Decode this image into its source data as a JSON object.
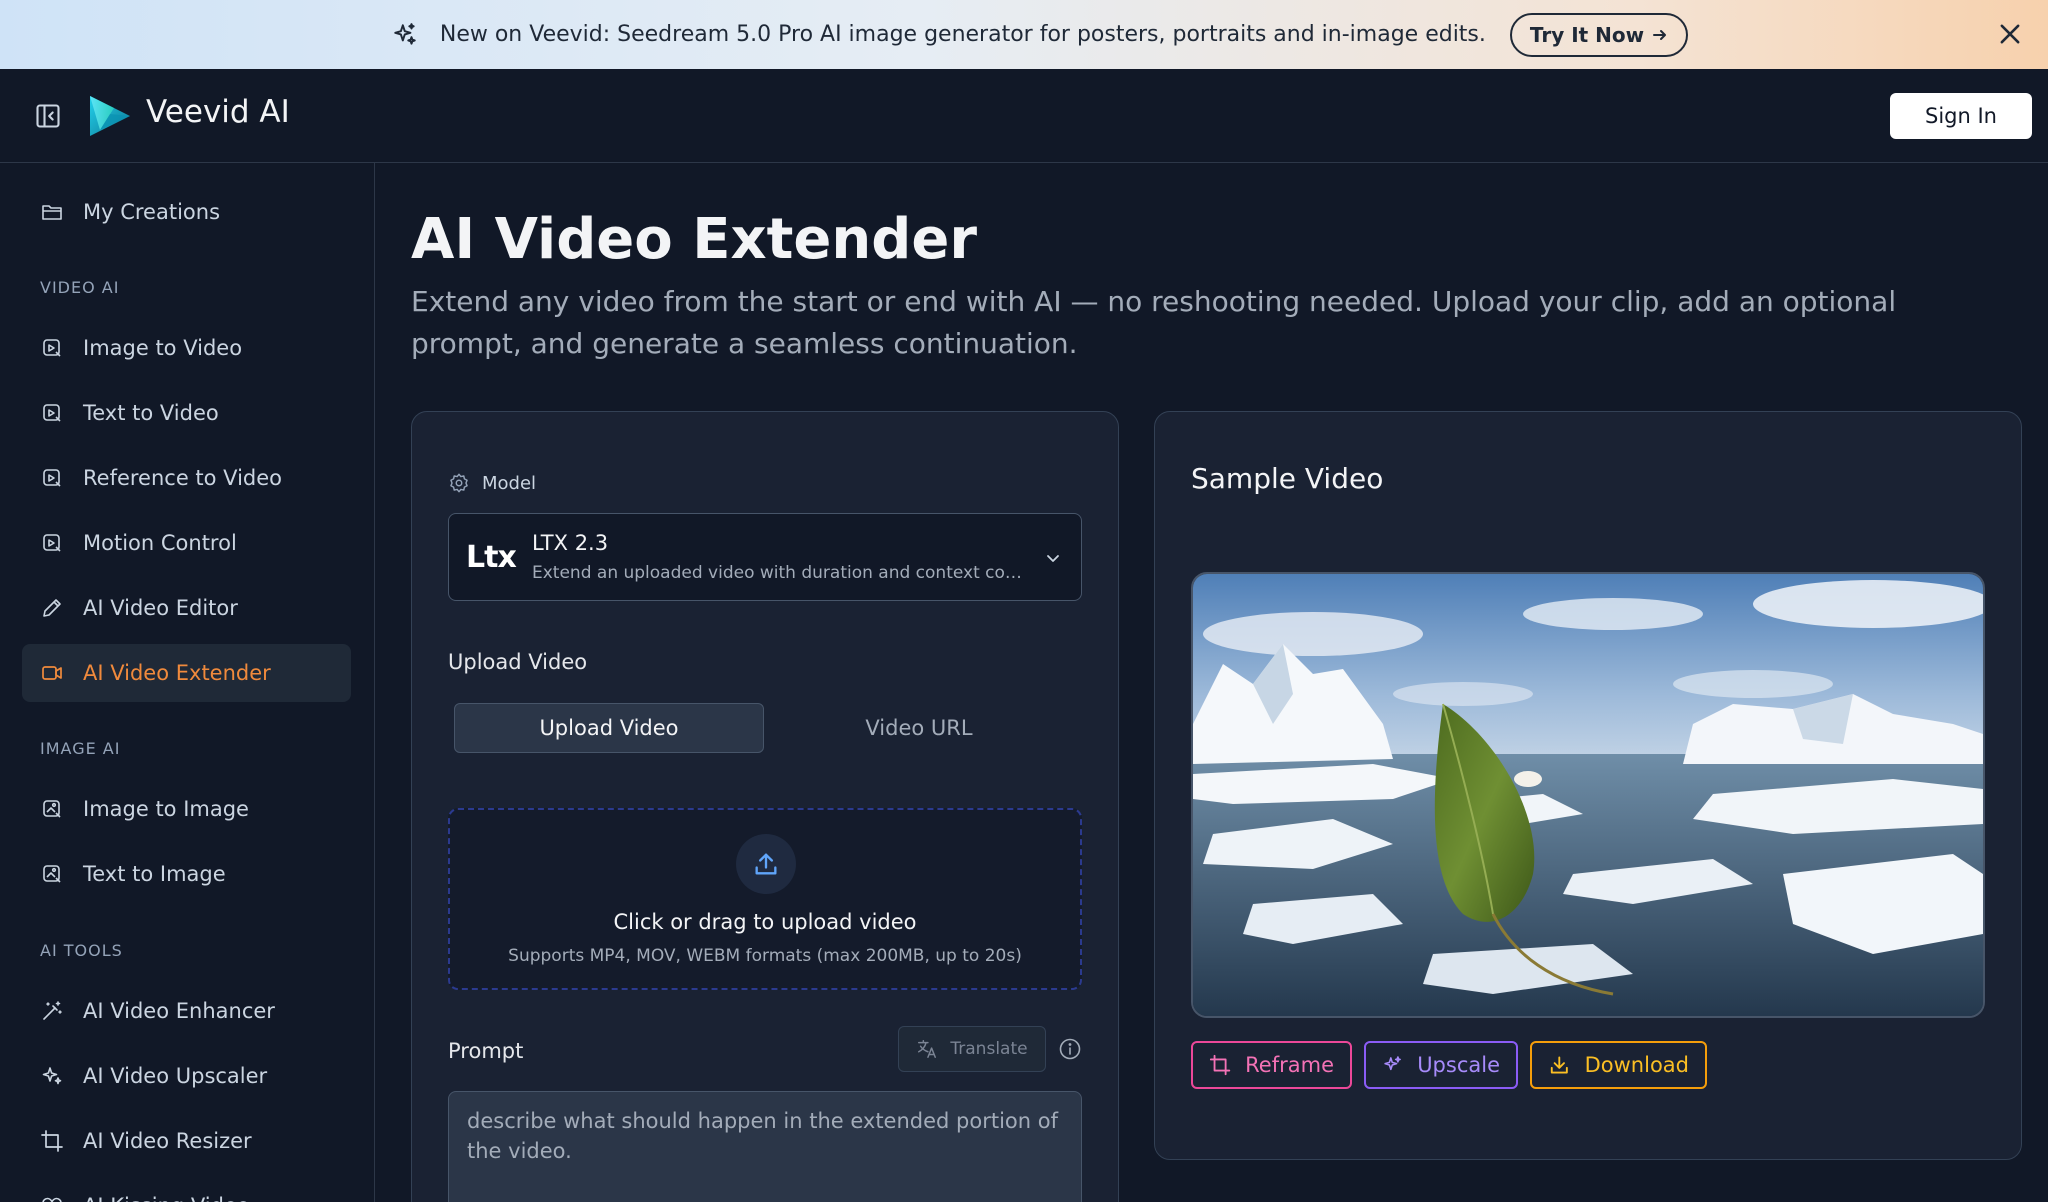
{
  "banner": {
    "text": "New on Veevid: Seedream 5.0 Pro AI image generator for posters, portraits and in-image edits.",
    "cta_label": "Try It Now",
    "icon": "sparkle-icon"
  },
  "header": {
    "brand": "Veevid AI",
    "signin_label": "Sign In"
  },
  "sidebar": {
    "top_item": {
      "label": "My Creations",
      "icon": "folder-icon"
    },
    "sections": [
      {
        "title": "VIDEO AI",
        "items": [
          {
            "label": "Image to Video",
            "icon": "image-video-icon"
          },
          {
            "label": "Text to Video",
            "icon": "text-video-icon"
          },
          {
            "label": "Reference to Video",
            "icon": "reference-video-icon"
          },
          {
            "label": "Motion Control",
            "icon": "motion-icon"
          },
          {
            "label": "AI Video Editor",
            "icon": "pencil-icon"
          },
          {
            "label": "AI Video Extender",
            "icon": "video-camera-icon",
            "active": true
          }
        ]
      },
      {
        "title": "IMAGE AI",
        "items": [
          {
            "label": "Image to Image",
            "icon": "image-icon"
          },
          {
            "label": "Text to Image",
            "icon": "text-image-icon"
          }
        ]
      },
      {
        "title": "AI TOOLS",
        "items": [
          {
            "label": "AI Video Enhancer",
            "icon": "magic-wand-icon"
          },
          {
            "label": "AI Video Upscaler",
            "icon": "sparkles-icon"
          },
          {
            "label": "AI Video Resizer",
            "icon": "crop-icon"
          },
          {
            "label": "AI Kissing Video",
            "icon": "heart-icon"
          }
        ]
      }
    ]
  },
  "main": {
    "title": "AI Video Extender",
    "subtitle": "Extend any video from the start or end with AI — no reshooting needed. Upload your clip, add an optional prompt, and generate a seamless continuation.",
    "form": {
      "model_label": "Model",
      "model": {
        "logo_text": "Ltx",
        "name": "LTX 2.3",
        "description": "Extend an uploaded video with duration and context controls"
      },
      "upload_label": "Upload Video",
      "tabs": [
        {
          "label": "Upload Video",
          "active": true
        },
        {
          "label": "Video URL",
          "active": false
        }
      ],
      "dropzone": {
        "title": "Click or drag to upload video",
        "subtitle": "Supports MP4, MOV, WEBM formats (max 200MB, up to 20s)"
      },
      "prompt_label": "Prompt",
      "translate_label": "Translate",
      "prompt_placeholder": "describe what should happen in the extended portion of the video."
    },
    "sample": {
      "title": "Sample Video",
      "buttons": [
        {
          "label": "Reframe",
          "icon": "crop-icon"
        },
        {
          "label": "Upscale",
          "icon": "sparkles-icon"
        },
        {
          "label": "Download",
          "icon": "download-icon"
        }
      ]
    }
  },
  "colors": {
    "background": "#111827",
    "panel": "#1a2233",
    "accent_orange": "#f08a3c",
    "reframe": "#ec4899",
    "upscale": "#8b5cf6",
    "download": "#f59e0b"
  }
}
